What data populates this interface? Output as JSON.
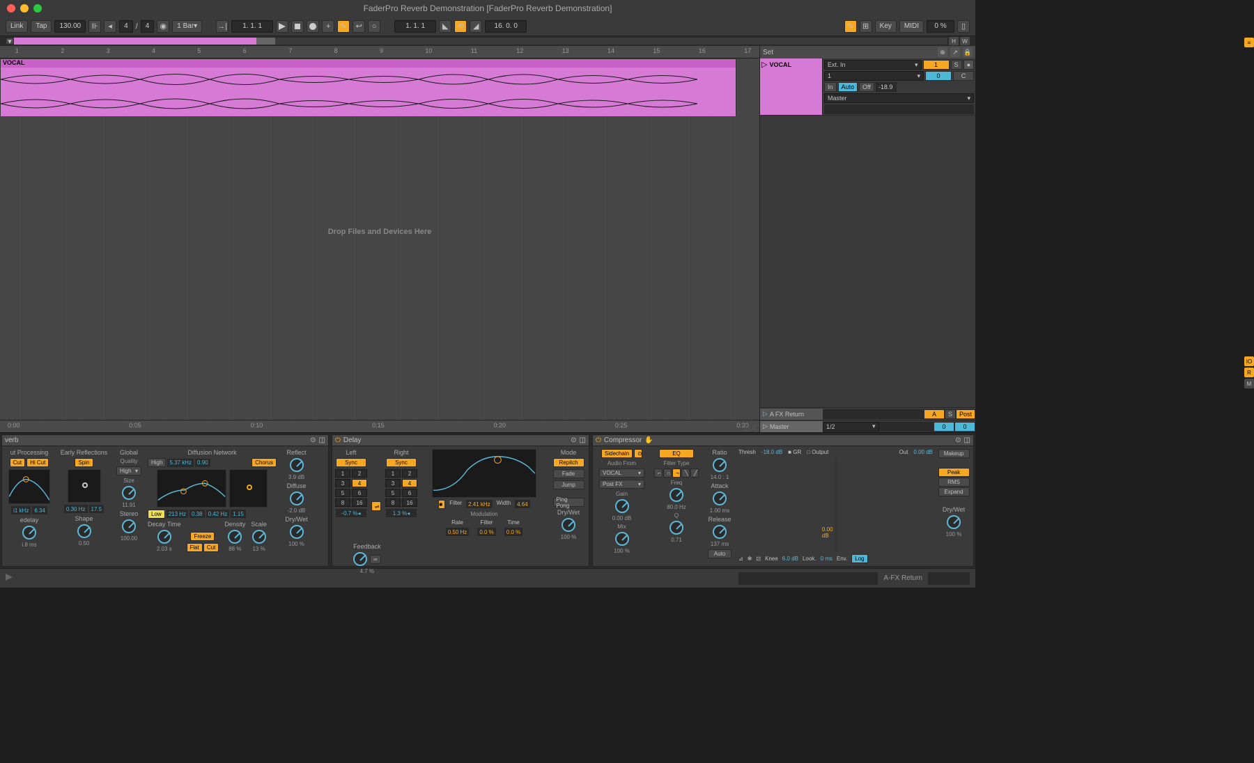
{
  "window": {
    "title": "FaderPro Reverb Demonstration  [FaderPro Reverb Demonstration]"
  },
  "toolbar": {
    "link": "Link",
    "tap": "Tap",
    "tempo": "130.00",
    "sig_num": "4",
    "sig_den": "4",
    "bar": "1 Bar",
    "position": "1.   1.   1",
    "loop_pos": "1.   1.   1",
    "loop_len": "16.   0.   0",
    "key": "Key",
    "midi": "MIDI",
    "pct": "0 %",
    "overview_h": "H",
    "overview_w": "W"
  },
  "ruler": {
    "ticks": [
      "1",
      "2",
      "3",
      "4",
      "5",
      "6",
      "7",
      "8",
      "9",
      "10",
      "11",
      "12",
      "13",
      "14",
      "15",
      "16",
      "17"
    ]
  },
  "time_ruler": {
    "ticks": [
      "0:00",
      "0:05",
      "0:10",
      "0:15",
      "0:20",
      "0:25",
      "0:30"
    ],
    "scale": "1/4"
  },
  "arrangement": {
    "clip_name": "VOCAL",
    "drop_hint": "Drop Files and Devices Here"
  },
  "set_header": {
    "label": "Set"
  },
  "tracks": {
    "vocal": {
      "name": "VOCAL",
      "input": "Ext. In",
      "channel": "1",
      "in_btn": "In",
      "auto_btn": "Auto",
      "off_btn": "Off",
      "output": "Master",
      "mon_one": "1",
      "send_zero": "0",
      "solo": "S",
      "cue": "C",
      "level": "-18.9"
    },
    "return_a": {
      "name": "A FX Return",
      "a_label": "A",
      "solo": "S",
      "post": "Post"
    },
    "master": {
      "name": "Master",
      "quantize": "1/2",
      "zero1": "0",
      "zero2": "0"
    }
  },
  "reverb": {
    "title": "verb",
    "sections": {
      "input": "ut Processing",
      "early": "Early Reflections",
      "global": "Global",
      "diffusion": "Diffusion Network",
      "reflect": "Reflect",
      "diffuse": "Diffuse"
    },
    "cut": "Cut",
    "hicut": "Hi Cut",
    "spin": "Spin",
    "quality": "Quality",
    "high": "High",
    "size": "Size",
    "dn_high": "High",
    "dn_freq": "5.37 kHz",
    "dn_q": "0.90",
    "chorus": "Chorus",
    "low": "Low",
    "low_freq": "213 Hz",
    "low_q": "0.38",
    "mid_freq": "0.42 Hz",
    "mid_q": "1.15",
    "freeze": "Freeze",
    "flat": "Flat",
    "cut2": "Cut",
    "input_freq": "i1 kHz",
    "input_q": "6.34",
    "early_rate": "0.30 Hz",
    "early_amt": "17.5",
    "size_val": "11.91",
    "reflect_val": "3.9 dB",
    "diffuse_val": "-2.0 dB",
    "predelay": "edelay",
    "shape": "Shape",
    "stereo": "Stereo",
    "decay": "Decay Time",
    "density": "Density",
    "scale": "Scale",
    "drywet": "Dry/Wet",
    "predelay_val": "i.8 ms",
    "shape_val": "0.50",
    "stereo_val": "100.00",
    "decay_val": "2.03 s",
    "density_val": "88 %",
    "scale_val": "13 %",
    "drywet_val": "100 %"
  },
  "delay": {
    "title": "Delay",
    "left": "Left",
    "right": "Right",
    "sync": "Sync",
    "mode": "Mode",
    "repitch": "Repitch",
    "fade": "Fade",
    "jump": "Jump",
    "pingpong": "Ping Pong",
    "filter": "Filter",
    "filter_freq": "2.41 kHz",
    "width": "Width",
    "width_val": "4.64",
    "modulation": "Modulation",
    "rate": "Rate",
    "filter_mod": "Filter",
    "time": "Time",
    "rate_val": "0.50 Hz",
    "filter_val": "0.0 %",
    "time_val": "0.0 %",
    "feedback": "Feedback",
    "feedback_val": "4.7 %",
    "left_offset": "-0.7 %",
    "right_offset": "1.3 %",
    "drywet": "Dry/Wet",
    "drywet_val": "100 %",
    "nums": [
      "1",
      "2",
      "3",
      "4",
      "5",
      "6",
      "8",
      "16"
    ]
  },
  "compressor": {
    "title": "Compressor",
    "sidechain": "Sidechain",
    "eq": "EQ",
    "audio_from": "Audio From",
    "source": "VOCAL",
    "postfx": "Post FX",
    "filter_type": "Filter Type",
    "gain": "Gain",
    "gain_val": "0.00 dB",
    "mix": "Mix",
    "mix_val": "100 %",
    "freq": "Freq",
    "freq_val": "80.0 Hz",
    "q": "Q",
    "q_val": "0.71",
    "ratio": "Ratio",
    "ratio_val": "14.0 : 1",
    "attack": "Attack",
    "attack_val": "1.00 ms",
    "release": "Release",
    "release_val": "137 ms",
    "auto": "Auto",
    "thresh": "Thresh",
    "thresh_val": "-18.0 dB",
    "gr": "GR",
    "output": "Output",
    "out": "Out",
    "out_val": "0.00 dB",
    "out_level": "0.00 dB",
    "makeup": "Makeup",
    "peak": "Peak",
    "rms": "RMS",
    "expand": "Expand",
    "drywet": "Dry/Wet",
    "drywet_val": "100 %",
    "knee": "Knee",
    "knee_val": "6.0 dB",
    "look": "Look.",
    "look_val": "0 ms",
    "env": "Env.",
    "log": "Log"
  },
  "status": {
    "return_label": "A-FX Return"
  }
}
